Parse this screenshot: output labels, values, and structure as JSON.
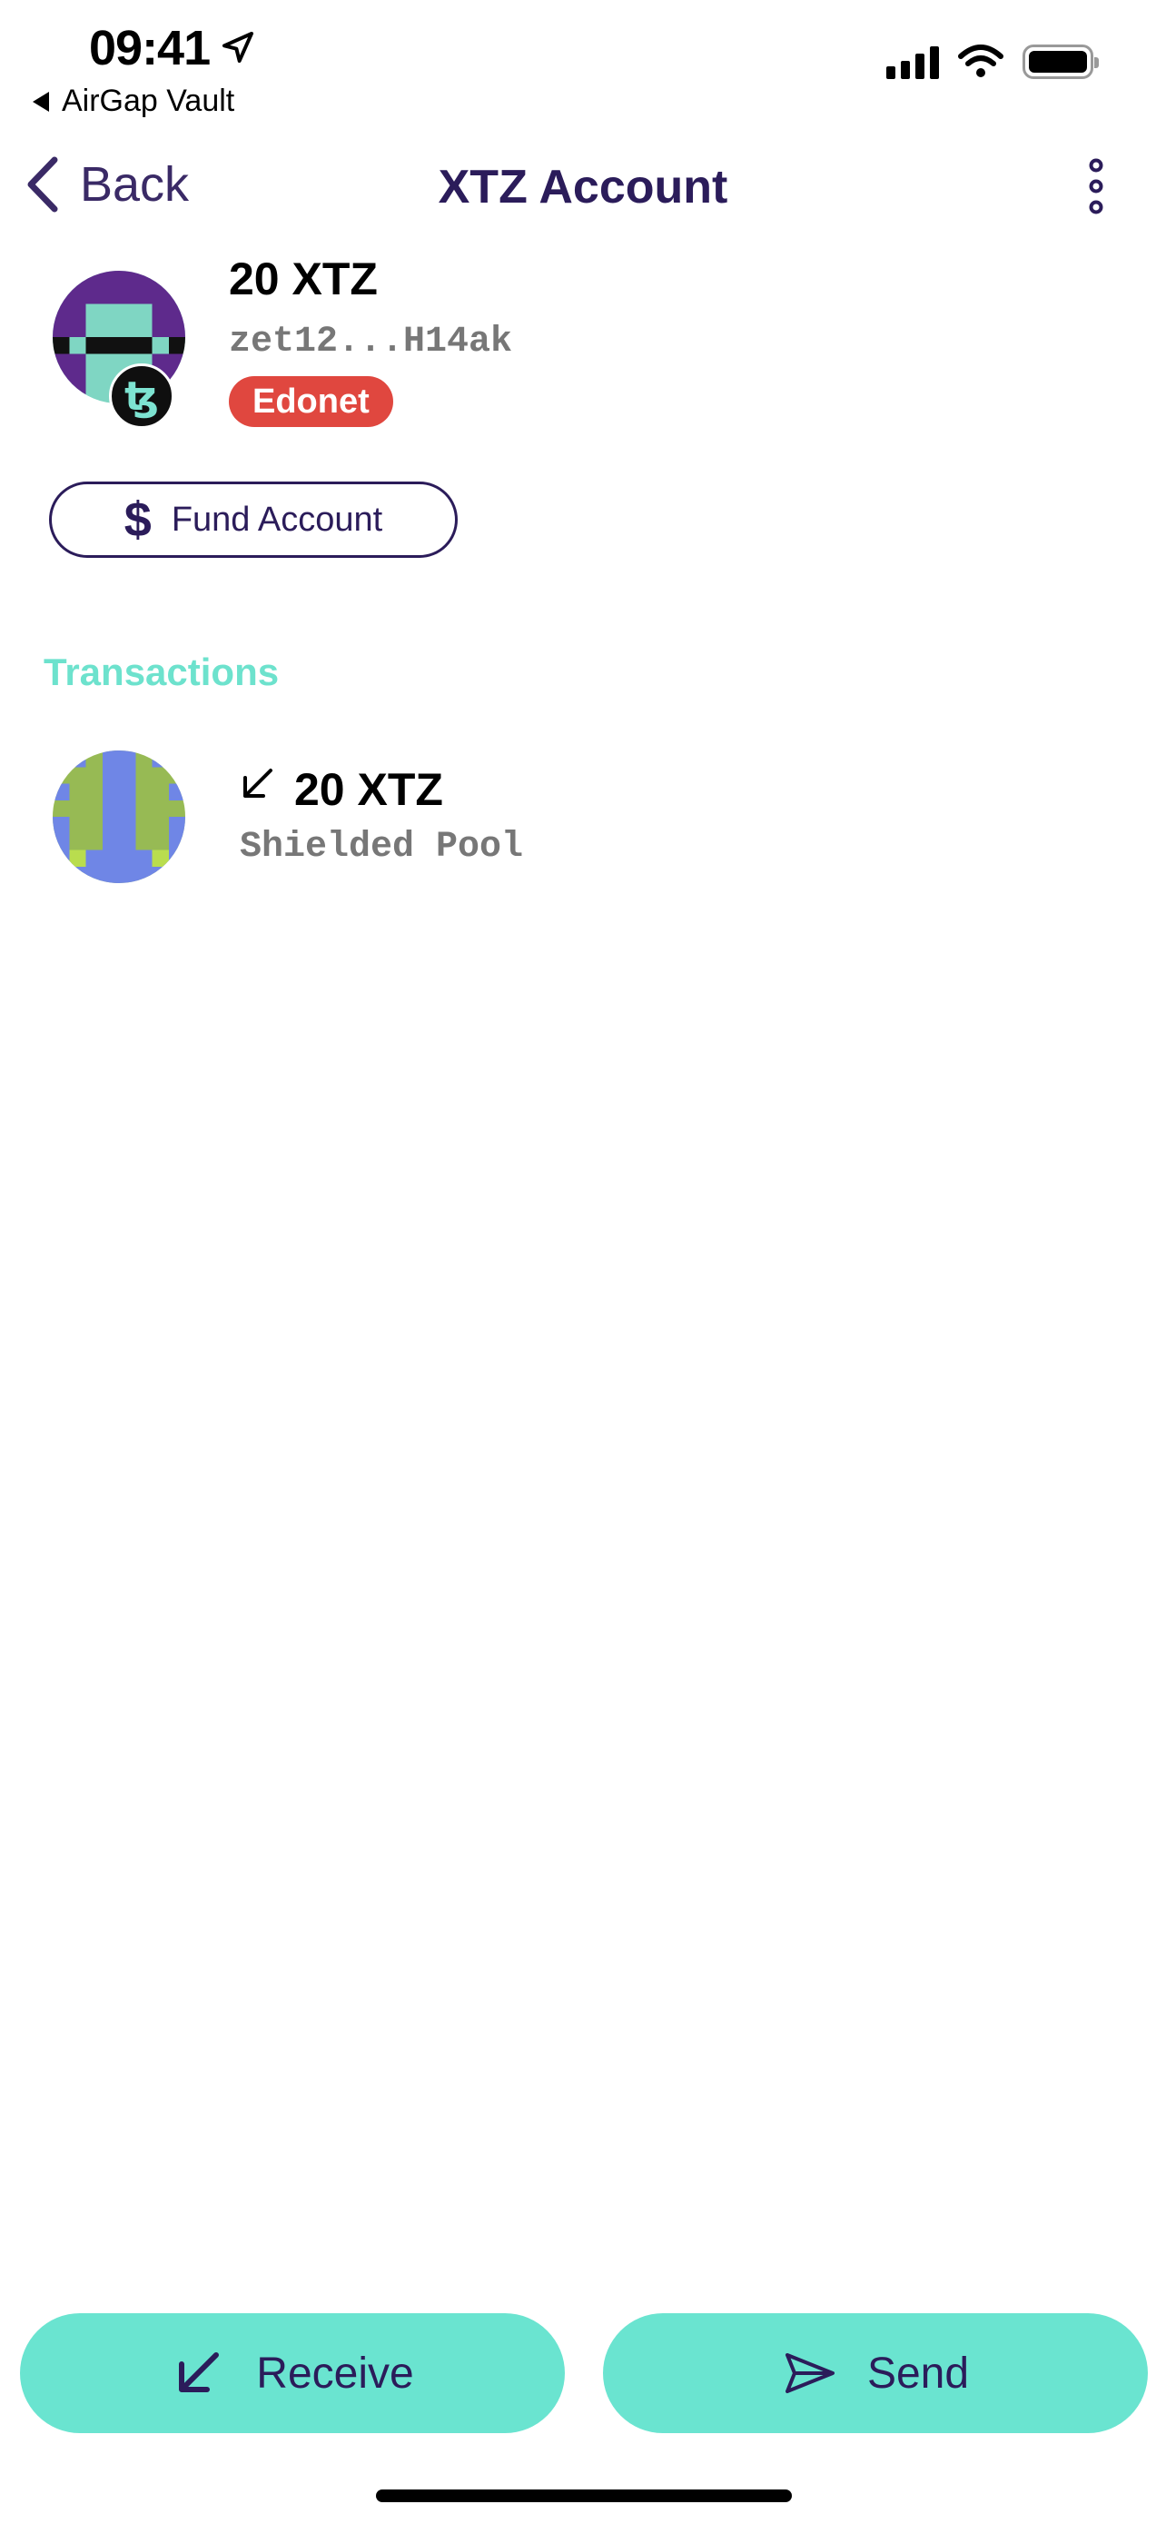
{
  "status_bar": {
    "time": "09:41",
    "back_app": "AirGap Vault",
    "location_icon": "location-arrow-icon",
    "signal_icon": "cellular-signal-icon",
    "wifi_icon": "wifi-icon",
    "battery_icon": "battery-icon"
  },
  "nav": {
    "back_label": "Back",
    "title": "XTZ Account",
    "more_icon": "more-vertical-icon"
  },
  "account": {
    "balance": "20 XTZ",
    "address": "zet12...H14ak",
    "network": "Edonet",
    "protocol_badge": "ꜩ",
    "colors": {
      "identicon_primary": "#5e2a8c",
      "identicon_secondary": "#7fd6c3",
      "network_badge": "#e0473f"
    }
  },
  "fund_button": {
    "icon": "dollar-icon",
    "label": "Fund Account"
  },
  "transactions": {
    "section_title": "Transactions",
    "items": [
      {
        "direction_icon": "arrow-down-left-icon",
        "amount": "20 XTZ",
        "description": "Shielded Pool"
      }
    ]
  },
  "actions": {
    "receive_label": "Receive",
    "receive_icon": "arrow-down-left-icon",
    "send_label": "Send",
    "send_icon": "paper-plane-icon"
  },
  "theme": {
    "accent": "#6ae4d0",
    "primary_text": "#2b1c5a",
    "section_title": "#6de2cd"
  }
}
